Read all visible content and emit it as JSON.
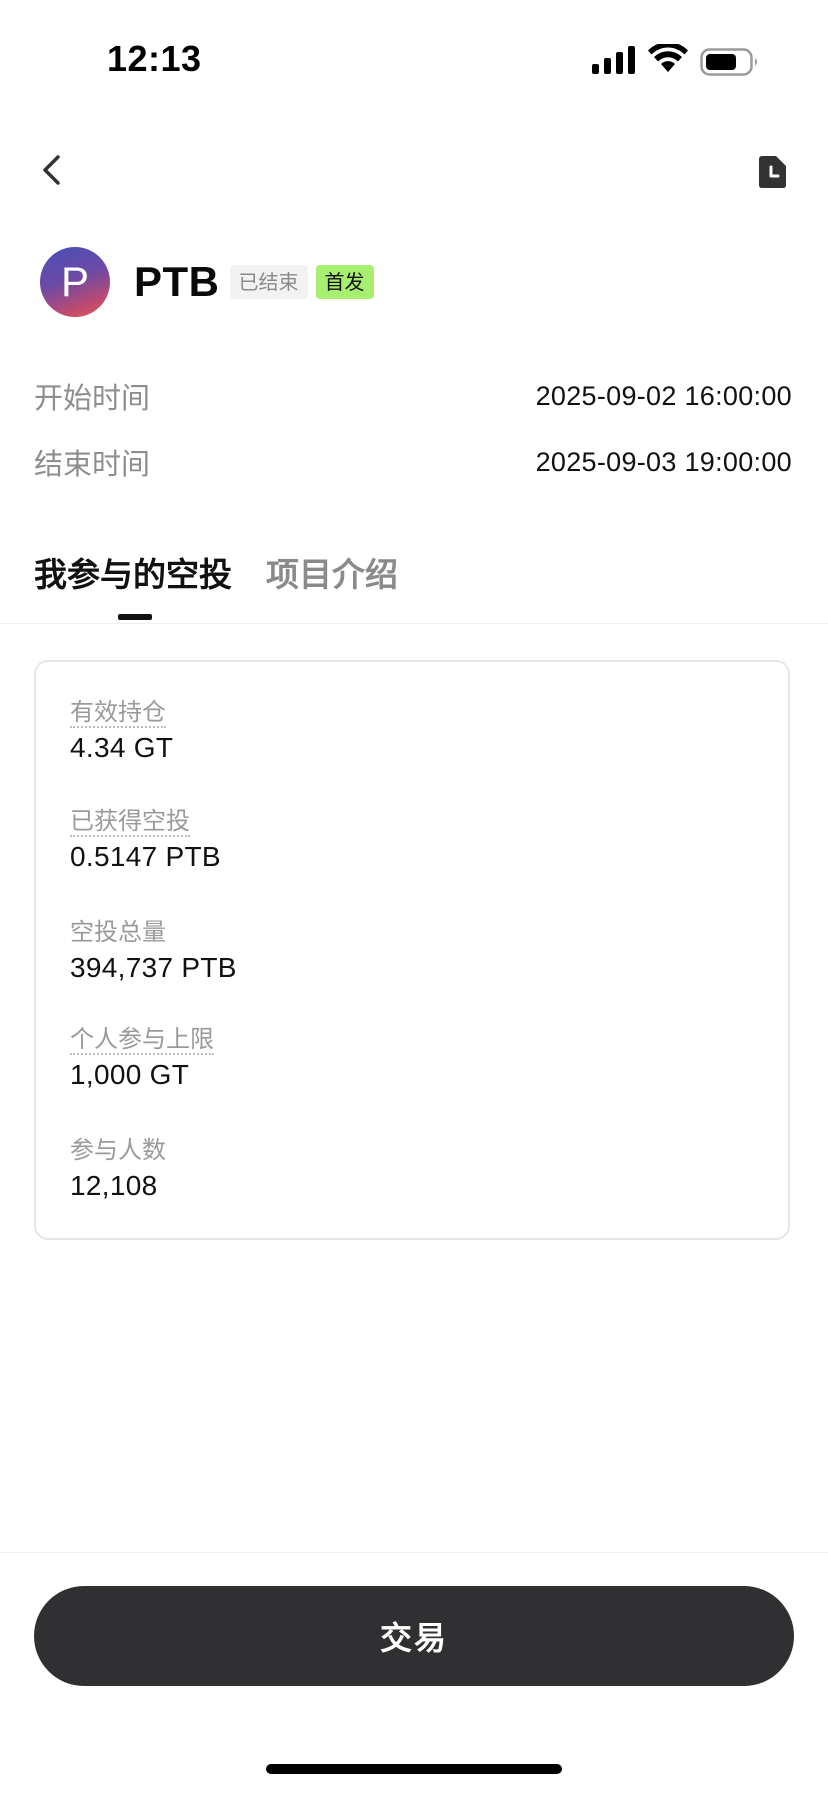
{
  "status_bar": {
    "time": "12:13",
    "icons": [
      "signal-icon",
      "wifi-icon",
      "battery-icon"
    ]
  },
  "nav": {
    "back_icon": "chevron-left-icon",
    "history_icon": "history-document-icon"
  },
  "token": {
    "logo_letter": "P",
    "symbol": "PTB",
    "status_badge": "已结束",
    "first_badge": "首发",
    "colors": {
      "first_badge_bg": "#a7ef6e",
      "status_badge_bg": "#f2f2f2"
    }
  },
  "schedule": {
    "start_label": "开始时间",
    "start_value": "2025-09-02 16:00:00",
    "end_label": "结束时间",
    "end_value": "2025-09-03 19:00:00"
  },
  "tabs": [
    {
      "label": "我参与的空投",
      "active": true
    },
    {
      "label": "项目介绍",
      "active": false
    }
  ],
  "stats": [
    {
      "label": "有效持仓",
      "value": "4.34 GT",
      "dotted": true
    },
    {
      "label": "已获得空投",
      "value": "0.5147 PTB",
      "dotted": true
    },
    {
      "label": "空投总量",
      "value": "394,737 PTB",
      "dotted": false
    },
    {
      "label": "个人参与上限",
      "value": "1,000 GT",
      "dotted": true
    },
    {
      "label": "参与人数",
      "value": "12,108",
      "dotted": false
    }
  ],
  "actions": {
    "trade_label": "交易",
    "colors": {
      "trade_bg": "#303033"
    }
  }
}
